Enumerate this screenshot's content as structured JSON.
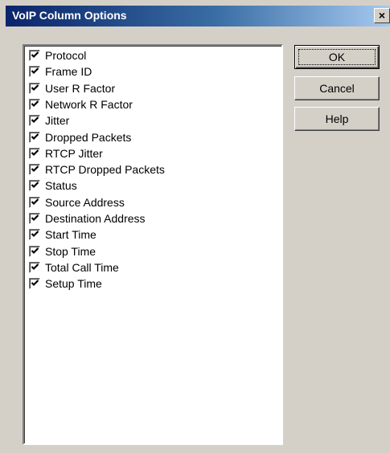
{
  "window": {
    "title": "VoIP Column Options",
    "close_label": "×"
  },
  "columns": [
    {
      "label": "Protocol",
      "checked": true
    },
    {
      "label": "Frame ID",
      "checked": true
    },
    {
      "label": "User R Factor",
      "checked": true
    },
    {
      "label": "Network R Factor",
      "checked": true
    },
    {
      "label": "Jitter",
      "checked": true
    },
    {
      "label": "Dropped Packets",
      "checked": true
    },
    {
      "label": "RTCP Jitter",
      "checked": true
    },
    {
      "label": "RTCP Dropped Packets",
      "checked": true
    },
    {
      "label": "Status",
      "checked": true
    },
    {
      "label": "Source Address",
      "checked": true
    },
    {
      "label": "Destination Address",
      "checked": true
    },
    {
      "label": "Start Time",
      "checked": true
    },
    {
      "label": "Stop Time",
      "checked": true
    },
    {
      "label": "Total Call Time",
      "checked": true
    },
    {
      "label": "Setup Time",
      "checked": true
    }
  ],
  "buttons": {
    "ok": "OK",
    "cancel": "Cancel",
    "help": "Help"
  }
}
